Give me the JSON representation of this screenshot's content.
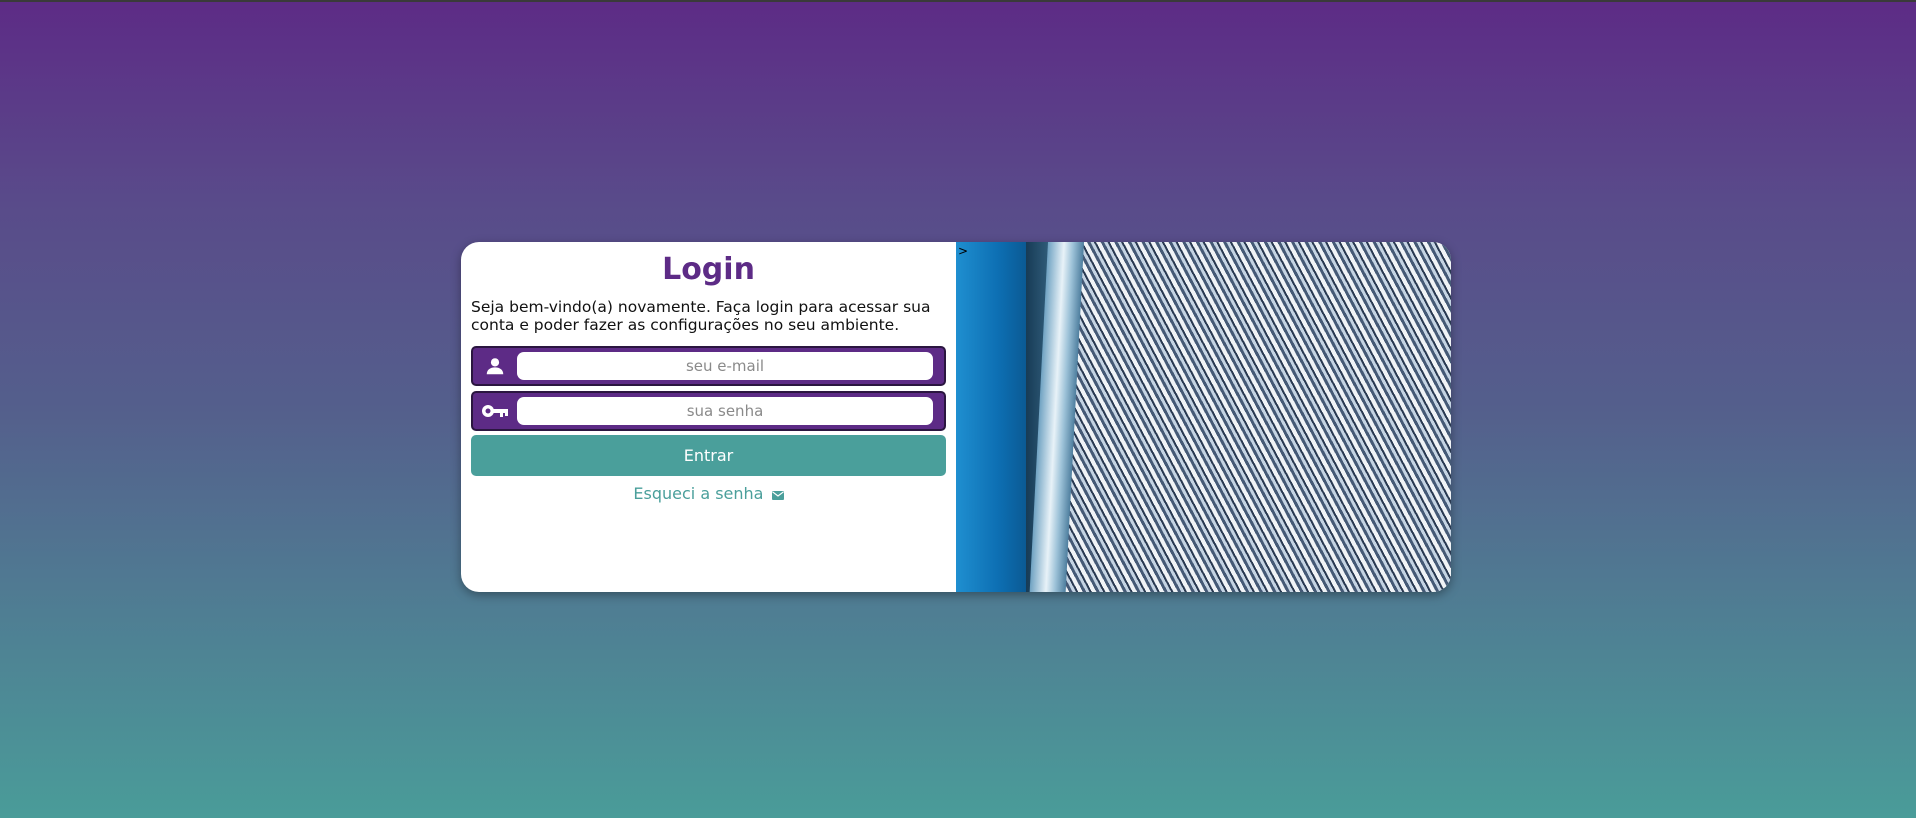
{
  "login": {
    "title": "Login",
    "welcome": "Seja bem-vindo(a) novamente. Faça login para acessar sua conta e poder fazer as configurações no seu ambiente.",
    "email_placeholder": "seu e-mail",
    "password_placeholder": "sua senha",
    "submit_label": "Entrar",
    "forgot_label": "Esqueci a senha"
  },
  "image_panel": {
    "stray_text": ">"
  },
  "icons": {
    "email": "user-icon",
    "password": "key-icon",
    "forgot": "mail-icon"
  },
  "colors": {
    "primary": "#5d2b86",
    "accent": "#4a9f9b",
    "background_top": "#5d2b86",
    "background_bottom": "#4a9c99"
  }
}
